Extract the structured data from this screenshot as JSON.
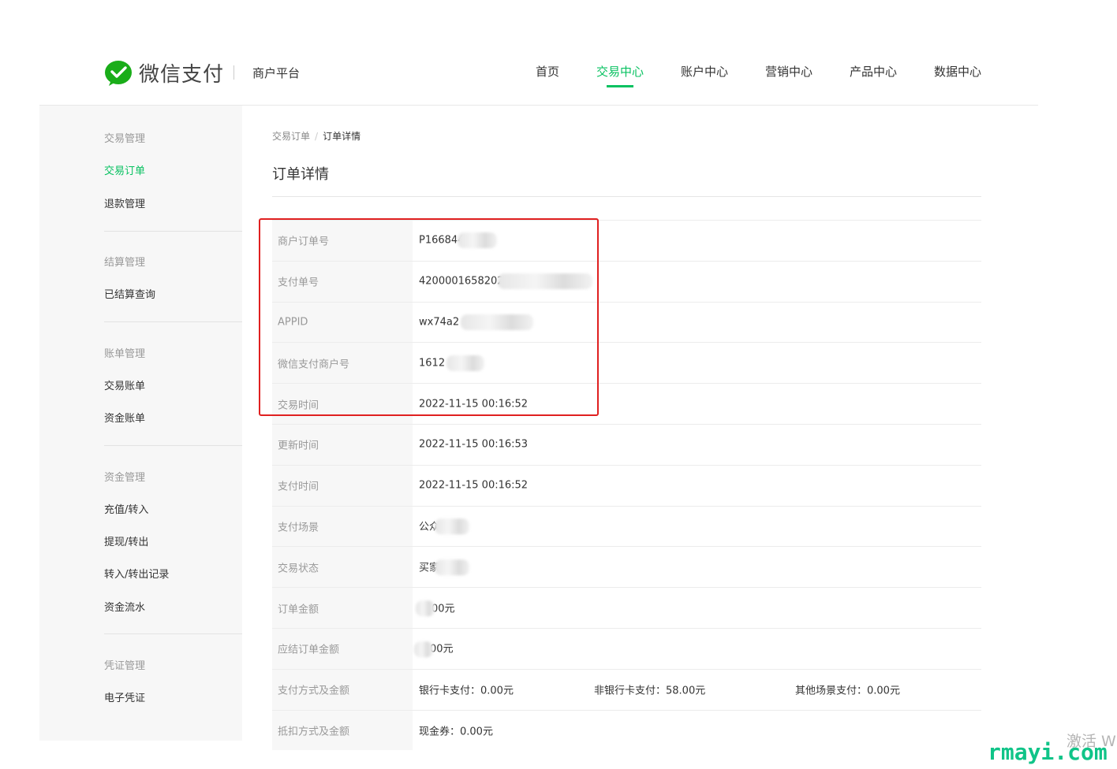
{
  "header": {
    "brand": "微信支付",
    "platform": "商户平台",
    "nav": [
      {
        "label": "首页",
        "active": false
      },
      {
        "label": "交易中心",
        "active": true
      },
      {
        "label": "账户中心",
        "active": false
      },
      {
        "label": "营销中心",
        "active": false
      },
      {
        "label": "产品中心",
        "active": false
      },
      {
        "label": "数据中心",
        "active": false
      }
    ]
  },
  "sidebar": {
    "groups": [
      {
        "title": "交易管理",
        "items": [
          "交易订单",
          "退款管理"
        ]
      },
      {
        "title": "结算管理",
        "items": [
          "已结算查询"
        ]
      },
      {
        "title": "账单管理",
        "items": [
          "交易账单",
          "资金账单"
        ]
      },
      {
        "title": "资金管理",
        "items": [
          "充值/转入",
          "提现/转出",
          "转入/转出记录",
          "资金流水"
        ]
      },
      {
        "title": "凭证管理",
        "items": [
          "电子凭证"
        ]
      }
    ],
    "active_item": "交易订单"
  },
  "breadcrumb": {
    "parent": "交易订单",
    "separator": "/",
    "current": "订单详情"
  },
  "page_title": "订单详情",
  "details": [
    {
      "label": "商户订单号",
      "value": "P166844"
    },
    {
      "label": "支付单号",
      "value": "4200001658202"
    },
    {
      "label": "APPID",
      "value": "wx74a2"
    },
    {
      "label": "微信支付商户号",
      "value": "1612"
    },
    {
      "label": "交易时间",
      "value": "2022-11-15 00:16:52"
    },
    {
      "label": "更新时间",
      "value": "2022-11-15 00:16:53"
    },
    {
      "label": "支付时间",
      "value": "2022-11-15 00:16:52"
    },
    {
      "label": "支付场景",
      "value": "公众"
    },
    {
      "label": "交易状态",
      "value": "买家"
    },
    {
      "label": "订单金额",
      "value": "00元"
    },
    {
      "label": "应结订单金额",
      "value": "00元"
    },
    {
      "label": "支付方式及金额",
      "value": "银行卡支付：0.00元",
      "value2": "非银行卡支付：58.00元",
      "value3": "其他场景支付：0.00元"
    },
    {
      "label": "抵扣方式及金额",
      "value": "现金券：0.00元"
    }
  ],
  "watermarks": {
    "activate": "激活 W",
    "site": "rmayi.com"
  },
  "colors": {
    "accent": "#07c160",
    "highlight": "#e02020",
    "watermark_site": "#10c488"
  }
}
